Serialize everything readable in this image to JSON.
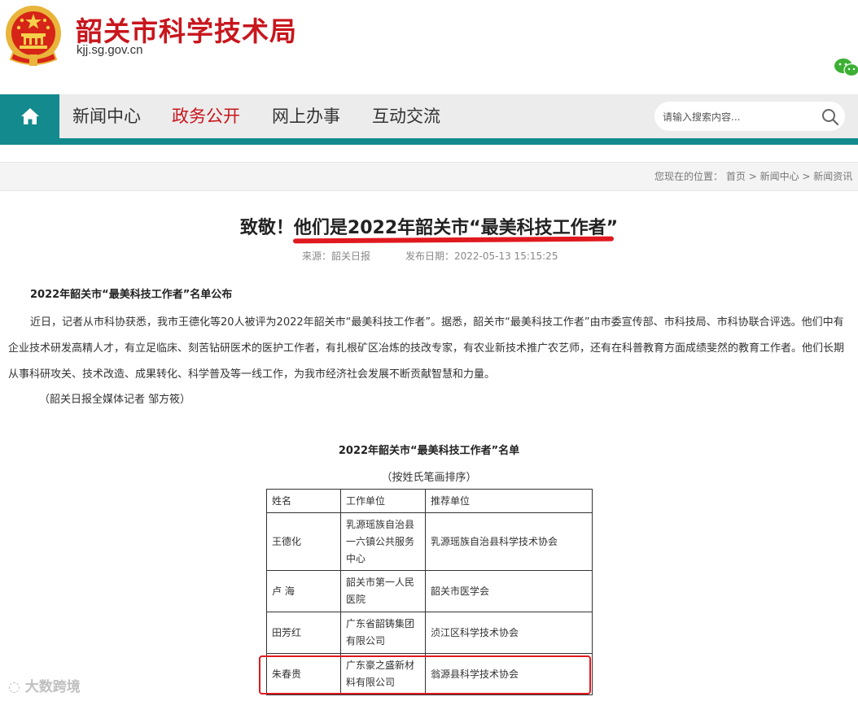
{
  "header": {
    "site_name": "韶关市科学技术局",
    "domain": "kjj.sg.gov.cn"
  },
  "nav": {
    "items": [
      {
        "label": "新闻中心",
        "active": false
      },
      {
        "label": "政务公开",
        "active": true
      },
      {
        "label": "网上办事",
        "active": false
      },
      {
        "label": "互动交流",
        "active": false
      }
    ],
    "search_placeholder": "请输入搜索内容..."
  },
  "breadcrumb": {
    "prefix": "您现在的位置：",
    "items": [
      "首页",
      "新闻中心",
      "新闻资讯"
    ]
  },
  "article": {
    "title_prefix": "致敬！",
    "title_main": "他们是2022年韶关市“最美科技工作者”",
    "source": "来源：韶关日报",
    "date": "发布日期：2022-05-13 15:15:25",
    "subhead": "2022年韶关市“最美科技工作者”名单公布",
    "paragraph": "近日，记者从市科协获悉，我市王德化等20人被评为2022年韶关市“最美科技工作者”。据悉，韶关市“最美科技工作者”由市委宣传部、市科技局、市科协联合评选。他们中有企业技术研发高精人才，有立足临床、刻苦钻研医术的医护工作者，有扎根矿区冶炼的技改专家，有农业新技术推广农艺师，还有在科普教育方面成绩斐然的教育工作者。他们长期从事科研攻关、技术改造、成果转化、科学普及等一线工作，为我市经济社会发展不断贡献智慧和力量。",
    "credit": "（韶关日报全媒体记者 邹方筱）",
    "list_title": "2022年韶关市“最美科技工作者”名单",
    "list_subtitle": "（按姓氏笔画排序）"
  },
  "table": {
    "headers": [
      "姓名",
      "工作单位",
      "推荐单位"
    ],
    "rows": [
      [
        "王德化",
        "乳源瑶族自治县一六镇公共服务中心",
        "乳源瑶族自治县科学技术协会"
      ],
      [
        "卢 海",
        "韶关市第一人民医院",
        "韶关市医学会"
      ],
      [
        "田芳红",
        "广东省韶铸集团有限公司",
        "浈江区科学技术协会"
      ],
      [
        "朱春贵",
        "广东豪之盛新材料有限公司",
        "翁源县科学技术协会"
      ]
    ]
  },
  "watermark": "大数跨境",
  "colors": {
    "brand_red": "#c8161d",
    "teal": "#128a8e",
    "annotation_red": "#e0191f"
  }
}
